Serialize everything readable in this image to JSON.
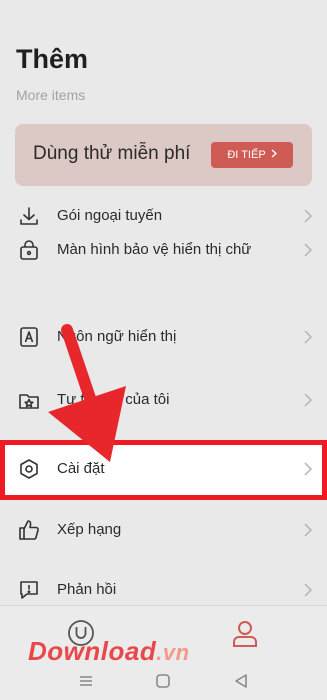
{
  "header": {
    "title": "Thêm",
    "subtitle": "More items"
  },
  "trial": {
    "text": "Dùng thử miễn phí",
    "button_label": "ĐI TIẾP",
    "button_color": "#cf5b55"
  },
  "menu": {
    "items": [
      {
        "label": "Gói ngoại tuyến",
        "icon": "download-icon"
      },
      {
        "label": "Màn hình bảo vệ hiển thị chữ",
        "icon": "lock-bag-icon"
      },
      {
        "label": "Ngôn ngữ hiển thị",
        "icon": "letter-a-icon"
      },
      {
        "label": "Tư tượng của tôi",
        "icon": "star-folder-icon"
      },
      {
        "label": "Cài đặt",
        "icon": "settings-hexagon-icon"
      },
      {
        "label": "Xếp hạng",
        "icon": "thumbs-up-icon"
      },
      {
        "label": "Phản hồi",
        "icon": "feedback-icon"
      }
    ]
  },
  "annotation": {
    "highlight_color": "#ee1b24",
    "arrow_color": "#e8272c"
  },
  "watermark": {
    "brand": "Download",
    "suffix": ".vn"
  },
  "bottom_nav": {
    "tabs": [
      {
        "icon": "u-circle-icon"
      },
      {
        "icon": "profile-icon",
        "active": true
      }
    ]
  }
}
